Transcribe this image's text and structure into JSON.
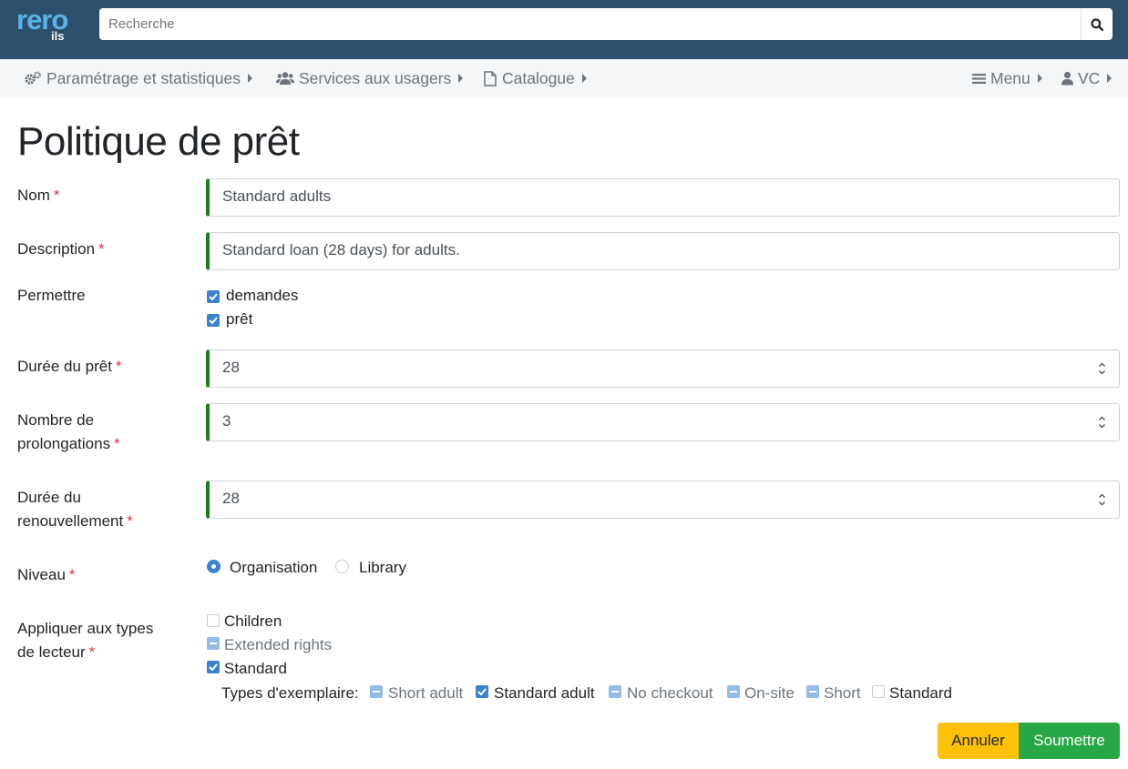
{
  "app": {
    "logo_main": "rero",
    "logo_sub": "ils",
    "search_placeholder": "Recherche"
  },
  "nav": {
    "settings": "Paramétrage et statistiques",
    "patrons": "Services aux usagers",
    "catalog": "Catalogue",
    "menu": "Menu",
    "user": "VC"
  },
  "page": {
    "title": "Politique de prêt"
  },
  "form": {
    "required_mark": "*",
    "name": {
      "label": "Nom",
      "value": "Standard adults"
    },
    "description": {
      "label": "Description",
      "value": "Standard loan (28 days) for adults."
    },
    "allow": {
      "label": "Permettre",
      "options": [
        {
          "label": "demandes",
          "checked": true
        },
        {
          "label": "prêt",
          "checked": true
        }
      ]
    },
    "checkout_duration": {
      "label": "Durée du prêt",
      "value": "28"
    },
    "renewals": {
      "label_line1": "Nombre de",
      "label_line2": "prolongations",
      "value": "3"
    },
    "renewal_duration": {
      "label_line1": "Durée du",
      "label_line2": "renouvellement",
      "value": "28"
    },
    "level": {
      "label": "Niveau",
      "options": [
        {
          "label": "Organisation",
          "selected": true
        },
        {
          "label": "Library",
          "selected": false
        }
      ]
    },
    "patron_types": {
      "label_line1": "Appliquer aux types",
      "label_line2": "de lecteur",
      "options": [
        {
          "label": "Children",
          "state": "unchecked"
        },
        {
          "label": "Extended rights",
          "state": "indeterminate"
        },
        {
          "label": "Standard",
          "state": "checked"
        }
      ],
      "item_types_label": "Types d'exemplaire:",
      "item_types": [
        {
          "label": "Short adult",
          "state": "indeterminate"
        },
        {
          "label": "Standard adult",
          "state": "checked"
        },
        {
          "label": "No checkout",
          "state": "indeterminate"
        },
        {
          "label": "On-site",
          "state": "indeterminate"
        },
        {
          "label": "Short",
          "state": "indeterminate"
        },
        {
          "label": "Standard",
          "state": "unchecked"
        }
      ]
    },
    "cancel_label": "Annuler",
    "submit_label": "Soumettre"
  },
  "colors": {
    "header_bg": "#2c4f6e",
    "valid_border": "#1c7d1c",
    "checkbox_blue": "#3b82d4",
    "cancel_bg": "#ffc107",
    "submit_bg": "#28a745",
    "required": "#dc3545"
  }
}
